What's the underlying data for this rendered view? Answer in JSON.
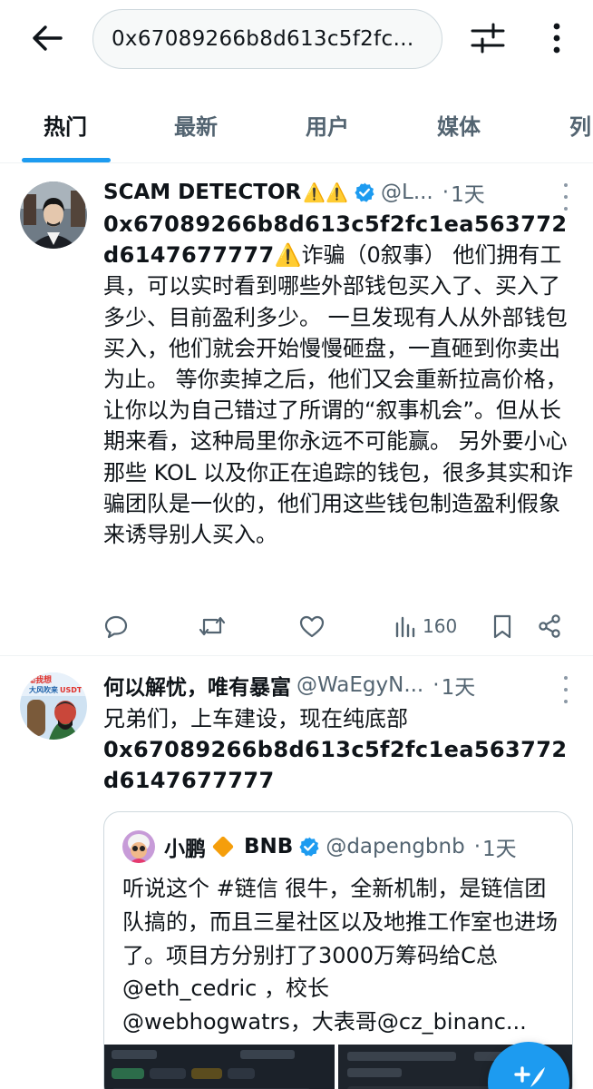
{
  "header": {
    "search_value": "0x67089266b8d613c5f2fc1ea563772d6147677777",
    "back_icon": "arrow-left-icon",
    "filter_icon": "sliders-icon",
    "more_icon": "vertical-dots-icon"
  },
  "tabs": [
    {
      "label": "热门",
      "active": true
    },
    {
      "label": "最新",
      "active": false
    },
    {
      "label": "用户",
      "active": false
    },
    {
      "label": "媒体",
      "active": false
    },
    {
      "label": "列",
      "active": false
    }
  ],
  "accent_color": "#1d9bf0",
  "tweets": [
    {
      "display_name": "SCAM DETECTOR",
      "name_emoji": "⚠️⚠️",
      "verified": true,
      "handle": "@L...",
      "dot": "·",
      "time": "1天",
      "address_line1": "0x67089266b8d613c5f2fc1ea563772d",
      "address_line2": "6147677777",
      "body_emoji": "⚠️",
      "body_text": "诈骗（0叙事） 他们拥有工具，可以实时看到哪些外部钱包买入了、买入了多少、目前盈利多少。 一旦发现有人从外部钱包买入，他们就会开始慢慢砸盘，一直砸到你卖出为止。 等你卖掉之后，他们又会重新拉高价格，让你以为自己错过了所谓的“叙事机会”。但从长期来看，这种局里你永远不可能赢。 另外要小心那些 KOL 以及你正在追踪的钱包，很多其实和诈骗团队是一伙的，他们用这些钱包制造盈利假象来诱导别人买入。",
      "views": "160"
    },
    {
      "display_name": "何以解忧，唯有暴富",
      "verified": false,
      "handle": "@WaEgyN...",
      "dot": "·",
      "time": "1天",
      "body_text": "兄弟们，上车建设，现在纯底部",
      "address_line1": "0x67089266b8d613c5f2fc1ea563772d",
      "address_line2": "6147677777",
      "avatar_text": {
        "top": "知我想",
        "mid": "大风吹来",
        "bottom": "USDT"
      },
      "quote": {
        "display_name": "小鹏",
        "badge": "BNB",
        "verified": true,
        "handle": "@dapengbnb",
        "dot": "·",
        "time": "1天",
        "body_main": "听说这个 #链信 很牛，全新机制，是链信团队搞的，而且三星社区以及地推工作室也进场了。项目方分别打了3000万筹码给C总@eth_cedric ，校长",
        "body_last": "@webhogwatrs，大表哥@cz_binanc..."
      }
    }
  ]
}
